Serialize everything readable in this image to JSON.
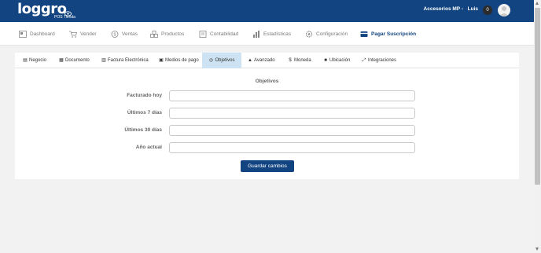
{
  "brand": {
    "logo": "loggro",
    "sub": "POS Tienda"
  },
  "header": {
    "store": "Accesorios MP -",
    "user": "Luis",
    "notifications": "0"
  },
  "nav": {
    "dashboard": "Dashboard",
    "vender": "Vender",
    "ventas": "Ventas",
    "productos": "Productos",
    "contabilidad": "Contabilidad",
    "estadisticas": "Estadísticas",
    "configuracion": "Configuración",
    "suscripcion": "Pagar Suscripción"
  },
  "tabs": {
    "negocio": "Negocio",
    "documento": "Documento",
    "factura": "Factura Electrónica",
    "medios": "Medios de pago",
    "objetivos": "Objetivos",
    "avanzado": "Avanzado",
    "moneda": "Moneda",
    "ubicacion": "Ubicación",
    "integraciones": "Integraciones"
  },
  "form": {
    "title": "Objetivos",
    "hoy": "Facturado hoy",
    "siete": "Últimos 7 días",
    "treinta": "Últimos 30 días",
    "anio": "Año actual",
    "save": "Guardar cambios"
  }
}
